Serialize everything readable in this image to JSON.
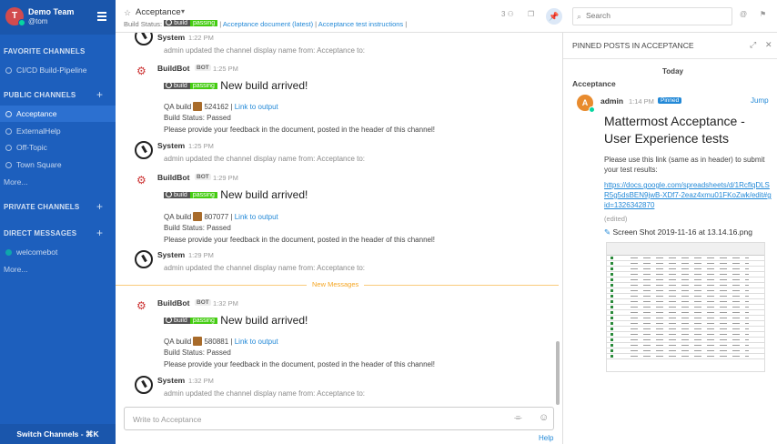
{
  "sidebar": {
    "team_initial": "T",
    "team_name": "Demo Team",
    "username": "@tom",
    "sections": {
      "favorite": "FAVORITE CHANNELS",
      "public": "PUBLIC CHANNELS",
      "private": "PRIVATE CHANNELS",
      "direct": "DIRECT MESSAGES"
    },
    "favorite_channels": [
      "CI/CD Build-Pipeline"
    ],
    "public_channels": [
      "Acceptance",
      "ExternalHelp",
      "Off-Topic",
      "Town Square"
    ],
    "public_more": "More...",
    "direct_messages": [
      "welcomebot"
    ],
    "direct_more": "More...",
    "switch_channels": "Switch Channels - ⌘K",
    "plus": "+"
  },
  "header": {
    "channel_name": "Acceptance",
    "build_status_label": "Build Status:",
    "badge_left": "build",
    "badge_right": "passing",
    "link_doc": "Acceptance document (latest)",
    "link_test": "Acceptance test instructions",
    "separator": "|",
    "member_count": "3",
    "search_placeholder": "Search"
  },
  "posts": {
    "system_name": "System",
    "bot_name": "BuildBot",
    "bot_tag": "BOT",
    "system_text": "admin updated the channel display name from: Acceptance to:",
    "new_build": "New build arrived!",
    "qa_prefix": "QA build",
    "link_output": "Link to output",
    "build_status": "Build Status: Passed",
    "feedback": "Please provide your feedback in the document, posted in the header of this channel!",
    "times": [
      "1:22 PM",
      "1:25 PM",
      "1:25 PM",
      "1:29 PM",
      "1:29 PM",
      "1:32 PM",
      "1:32 PM"
    ],
    "builds": [
      "524162",
      "807077",
      "580881"
    ],
    "new_messages": "New Messages"
  },
  "composer": {
    "placeholder": "Write to Acceptance",
    "help": "Help"
  },
  "rhs": {
    "title": "PINNED POSTS IN ACCEPTANCE",
    "date_separator": "Today",
    "channel": "Acceptance",
    "avatar_initial": "A",
    "author": "admin",
    "time": "1:14 PM",
    "pinned_tag": "Pinned",
    "jump": "Jump",
    "heading": "Mattermost Acceptance - User Experience tests",
    "body": "Please use this link (same as in header) to submit your test results:",
    "url": "https://docs.google.com/spreadsheets/d/1RcflqDLSR5g5dsBEN9jwB-XDf7-2eaz4xmu01FKoZwk/edit#gid=1326342870",
    "edited": "(edited)",
    "attachment": "Screen Shot 2019-11-16 at 13.14.16.png"
  }
}
